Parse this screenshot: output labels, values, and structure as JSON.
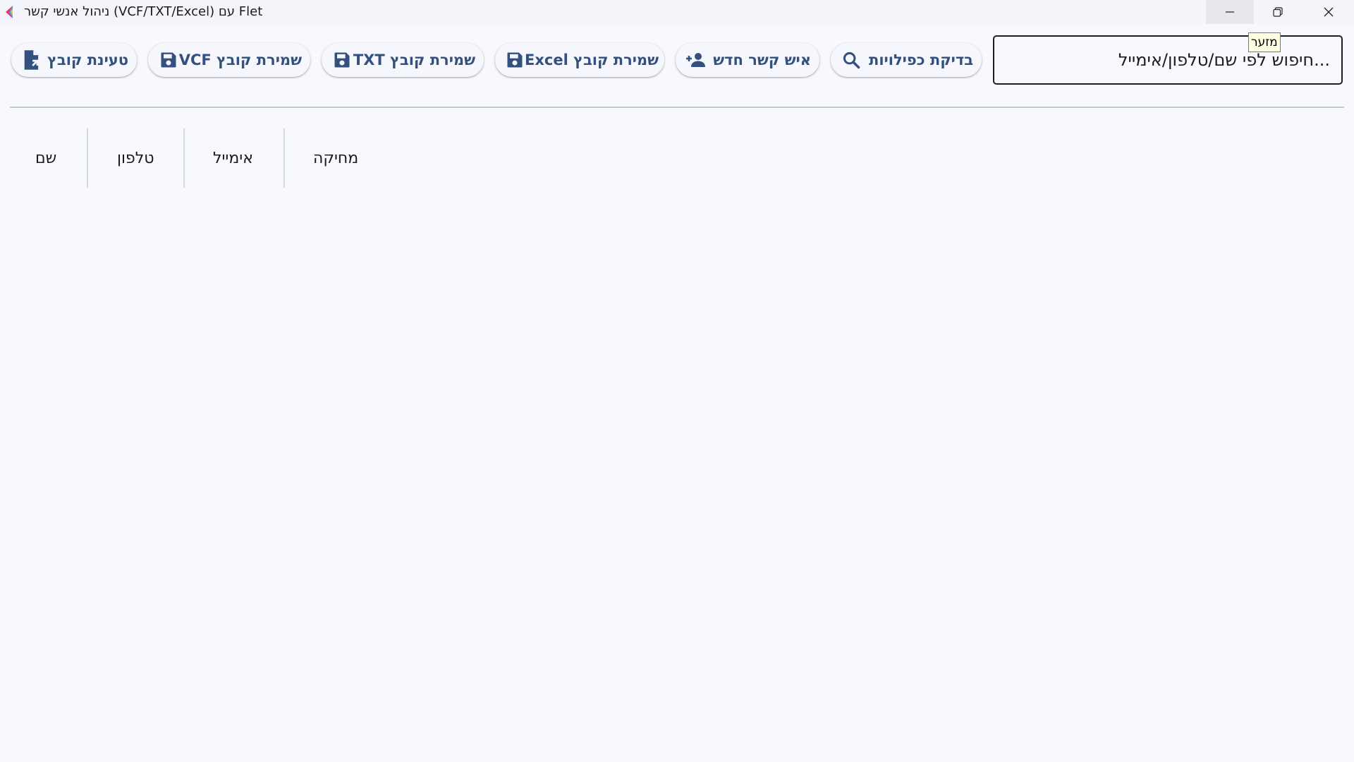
{
  "window": {
    "title": "ניהול אנשי קשר (VCF/TXT/Excel) עם Flet",
    "minimize_tooltip": "מזער"
  },
  "toolbar": {
    "search_placeholder": "...חיפוש לפי שם/טלפון/אימייל",
    "buttons": {
      "duplicates": {
        "label": "בדיקת כפילויות",
        "icon": "search-icon"
      },
      "new_contact": {
        "label": "איש קשר חדש",
        "icon": "person-add-icon"
      },
      "save_excel": {
        "label": "שמירת קובץ Excel",
        "icon": "save-icon"
      },
      "save_txt": {
        "label": "שמירת קובץ TXT",
        "icon": "save-icon"
      },
      "save_vcf": {
        "label": "שמירת קובץ VCF",
        "icon": "save-icon"
      },
      "load_file": {
        "label": "טעינת קובץ",
        "icon": "file-open-icon"
      }
    }
  },
  "table": {
    "columns": [
      "שם",
      "טלפון",
      "אימייל",
      "מחיקה"
    ]
  },
  "colors": {
    "accent": "#34507e",
    "background": "#f8f9fe",
    "text": "#1b1b1f"
  }
}
